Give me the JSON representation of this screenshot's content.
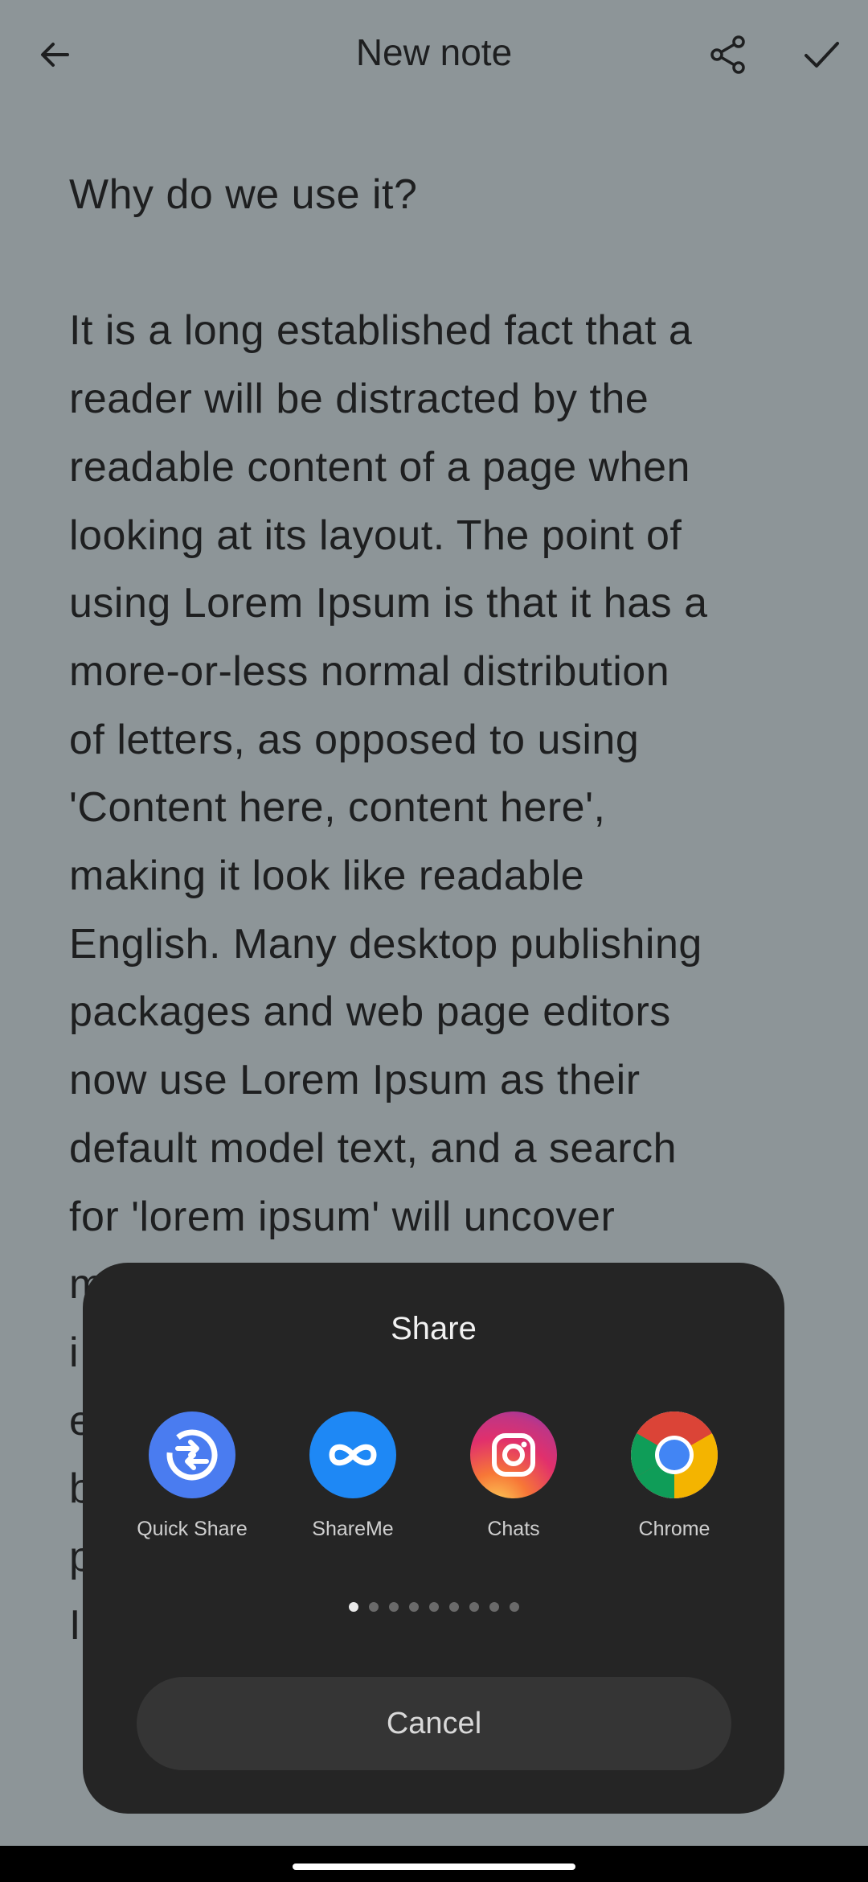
{
  "appbar": {
    "title": "New note",
    "icons": [
      "back-arrow-icon",
      "share-icon",
      "checkmark-icon"
    ]
  },
  "note": {
    "heading": "Why do we use it?",
    "body": "It is a long established fact that a\nreader will be distracted by the\nreadable content of a page when\nlooking at its layout. The point of\nusing Lorem Ipsum is that it has a\nmore-or-less normal distribution\nof letters, as opposed to using\n'Content here, content here',\nmaking it look like readable\nEnglish. Many desktop publishing\npackages and web page editors\nnow use Lorem Ipsum as their\ndefault model text, and a search\nfor 'lorem ipsum' will uncover\nm\ni\ne\nb\np\nI"
  },
  "share_sheet": {
    "title": "Share",
    "apps": [
      {
        "label": "Quick Share",
        "icon": "quick-share-icon",
        "color": "#4a7cf0"
      },
      {
        "label": "ShareMe",
        "icon": "shareme-icon",
        "color": "#1e88f5"
      },
      {
        "label": "Chats",
        "icon": "instagram-icon",
        "color": "#e1306c"
      },
      {
        "label": "Chrome",
        "icon": "chrome-icon",
        "color": "#4285f4"
      }
    ],
    "page_count": 9,
    "current_page": 1,
    "cancel_label": "Cancel"
  },
  "colors": {
    "scrim_background": "#8d9598",
    "sheet_background": "#252525",
    "cancel_background": "#353535"
  }
}
